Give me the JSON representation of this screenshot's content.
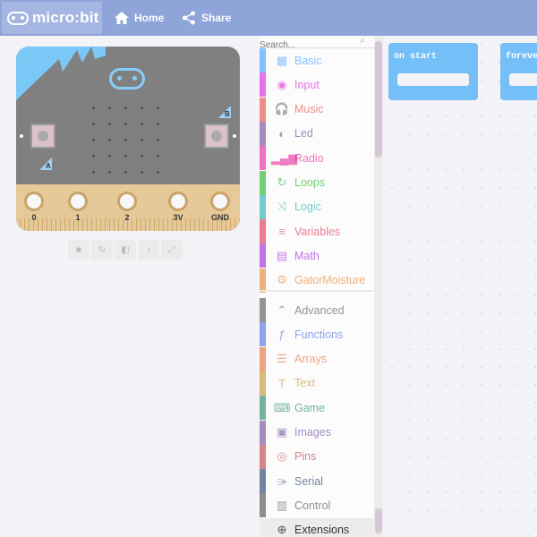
{
  "header": {
    "logo_text": "micro:bit",
    "nav": [
      {
        "label": "Home",
        "icon": "home-icon"
      },
      {
        "label": "Share",
        "icon": "share-icon"
      }
    ]
  },
  "simulator": {
    "pins": [
      "0",
      "1",
      "2",
      "3V",
      "GND"
    ],
    "button_a": "A",
    "button_b": "B",
    "toolbar": [
      {
        "icon": "stop-icon"
      },
      {
        "icon": "restart-icon"
      },
      {
        "icon": "slowmo-icon"
      },
      {
        "icon": "mute-icon"
      },
      {
        "icon": "fullscreen-icon"
      }
    ]
  },
  "toolbox": {
    "search_placeholder": "Search...",
    "categories": [
      {
        "label": "Basic",
        "color": "#1e90ff",
        "icon": "grid-icon"
      },
      {
        "label": "Input",
        "color": "#d400d4",
        "icon": "input-icon"
      },
      {
        "label": "Music",
        "color": "#e63022",
        "icon": "headphones-icon"
      },
      {
        "label": "Led",
        "color": "#5c2d91",
        "icon": "toggle-icon"
      },
      {
        "label": "Radio",
        "color": "#e3008c",
        "icon": "signal-icon"
      },
      {
        "label": "Loops",
        "color": "#00aa00",
        "icon": "loop-icon"
      },
      {
        "label": "Logic",
        "color": "#00a4a6",
        "icon": "shuffle-icon"
      },
      {
        "label": "Variables",
        "color": "#dc143c",
        "icon": "lines-icon"
      },
      {
        "label": "Math",
        "color": "#9400d3",
        "icon": "calculator-icon"
      },
      {
        "label": "GatorMoisture",
        "color": "#e6710c",
        "icon": "gear-icon"
      }
    ],
    "advanced": [
      {
        "label": "Advanced",
        "color": "#3c3c3c",
        "icon": "chevron-up-icon"
      },
      {
        "label": "Functions",
        "color": "#3455db",
        "icon": "function-icon"
      },
      {
        "label": "Arrays",
        "color": "#e65722",
        "icon": "list-icon"
      },
      {
        "label": "Text",
        "color": "#b8860b",
        "icon": "text-icon"
      },
      {
        "label": "Game",
        "color": "#007a4b",
        "icon": "gamepad-icon"
      },
      {
        "label": "Images",
        "color": "#5c2d91",
        "icon": "image-icon"
      },
      {
        "label": "Pins",
        "color": "#b22222",
        "icon": "pins-icon"
      },
      {
        "label": "Serial",
        "color": "#002050",
        "icon": "usb-icon"
      },
      {
        "label": "Control",
        "color": "#333333",
        "icon": "control-icon"
      },
      {
        "label": "Extensions",
        "color": "#666666",
        "icon": "plus-circle-icon"
      }
    ]
  },
  "workspace": {
    "blocks": [
      {
        "label": "on start"
      },
      {
        "label": "forever"
      }
    ]
  }
}
